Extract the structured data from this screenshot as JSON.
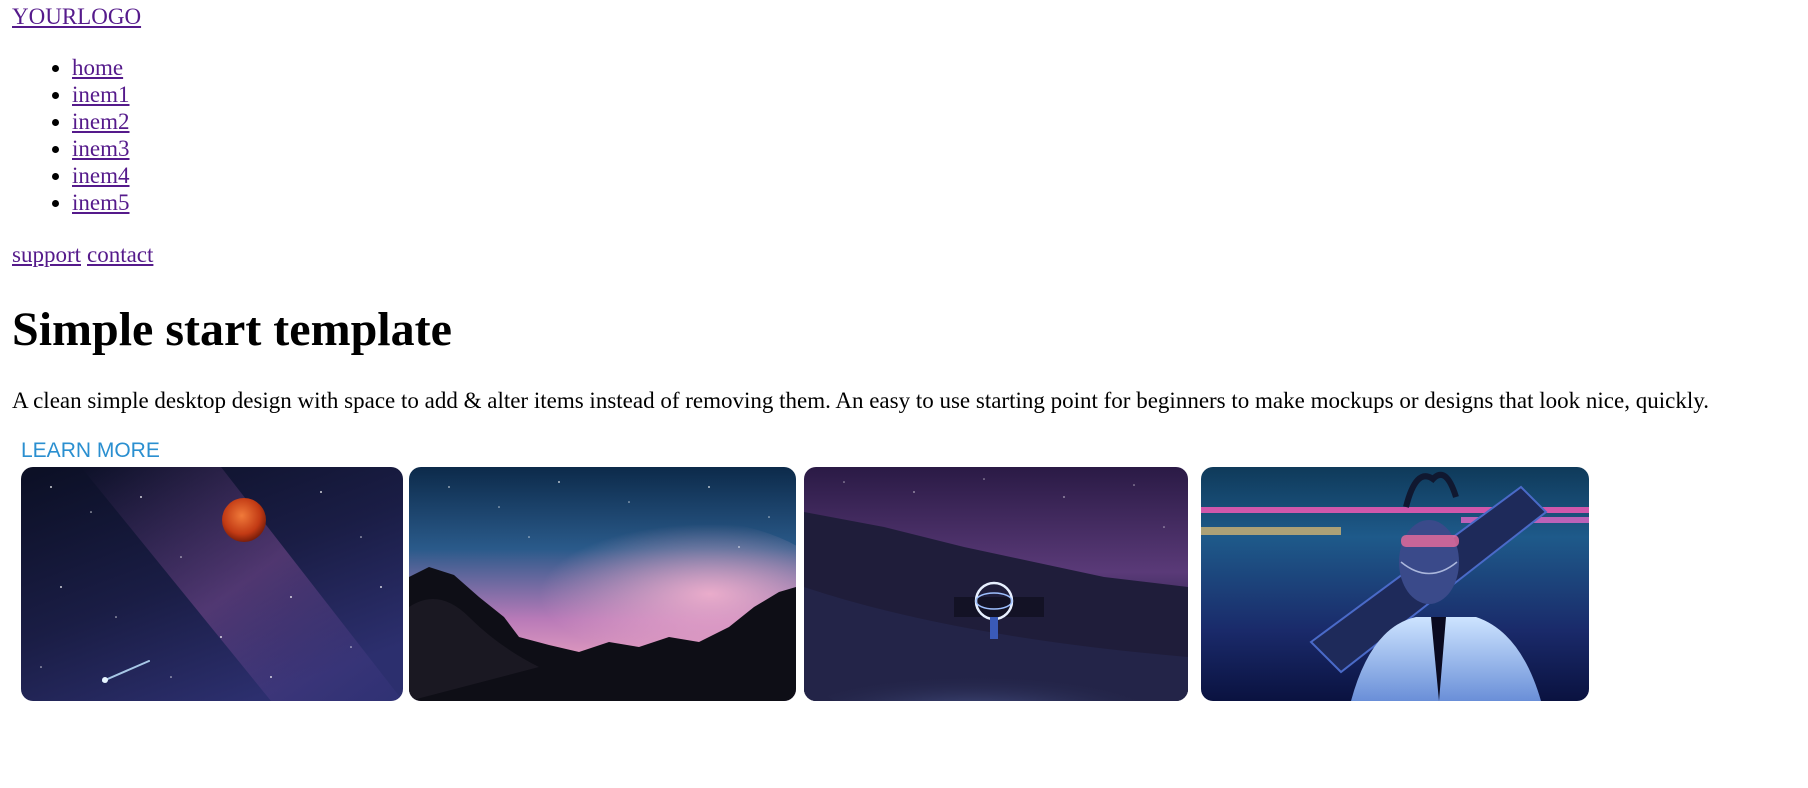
{
  "header": {
    "logo": "YOURLOGO"
  },
  "nav": {
    "items": [
      {
        "label": "home"
      },
      {
        "label": "inem1"
      },
      {
        "label": "inem2"
      },
      {
        "label": "inem3"
      },
      {
        "label": "inem4"
      },
      {
        "label": "inem5"
      }
    ]
  },
  "secondary_nav": {
    "support": "support",
    "contact": "contact"
  },
  "hero": {
    "title": "Simple start template",
    "description": "A clean simple desktop design with space to add & alter items instead of removing them. An easy to use starting point for beginners to make mockups or designs that look nice, quickly.",
    "cta": "LEARN MORE"
  },
  "gallery": {
    "images": [
      {
        "subject": "night sky with red moon and shooting star"
      },
      {
        "subject": "rocky silhouette under pink and blue night sky"
      },
      {
        "subject": "light painter with glowing orb on snowy slope at night"
      },
      {
        "subject": "neon-lit figure with glasses carrying a large prop rifle"
      }
    ]
  },
  "colors": {
    "link_visited": "#551a8b",
    "cta": "#2a8fd0",
    "background": "#ffffff",
    "text": "#000000"
  }
}
